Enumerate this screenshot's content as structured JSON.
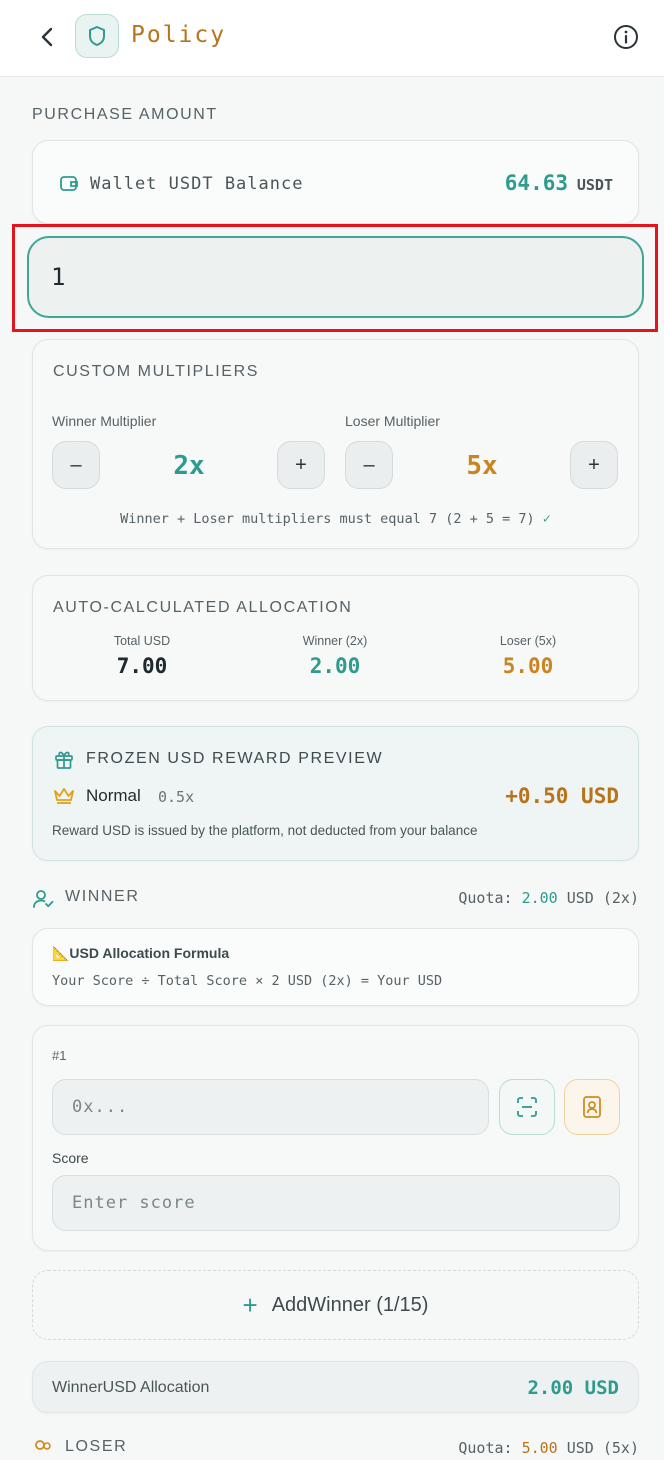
{
  "header": {
    "title": "Policy",
    "back_icon": "chevron-left-icon",
    "logo_icon": "shield-icon",
    "info_icon": "info-icon"
  },
  "purchase": {
    "section_label": "PURCHASE AMOUNT",
    "wallet_label": "Wallet USDT Balance",
    "wallet_value": "64.63",
    "wallet_unit": "USDT",
    "amount_value": "1"
  },
  "multipliers": {
    "header": "CUSTOM MULTIPLIERS",
    "winner_label": "Winner Multiplier",
    "winner_value": "2x",
    "loser_label": "Loser Multiplier",
    "loser_value": "5x",
    "minus": "–",
    "plus": "+",
    "note": "Winner + Loser multipliers must equal 7 (2 + 5 = 7)",
    "note_check": "✓"
  },
  "allocation": {
    "header": "AUTO-CALCULATED ALLOCATION",
    "total_label": "Total USD",
    "total_value": "7.00",
    "winner_label": "Winner (2x)",
    "winner_value": "2.00",
    "loser_label": "Loser (5x)",
    "loser_value": "5.00"
  },
  "frozen": {
    "header": "FROZEN USD REWARD PREVIEW",
    "tier": "Normal",
    "tier_multiplier": "0.5x",
    "reward": "+0.50 USD",
    "note": "Reward USD is issued by the platform, not deducted from your balance"
  },
  "winner": {
    "label": "WINNER",
    "quota_prefix": "Quota:",
    "quota_value": "2.00",
    "quota_suffix": "USD (2x)",
    "formula_title": "📐USD Allocation Formula",
    "formula_text": "Your Score ÷ Total Score × 2 USD (2x) = Your USD",
    "entry_number": "#1",
    "address_placeholder": "0x...",
    "score_label": "Score",
    "score_placeholder": "Enter score",
    "add_button": "AddWinner (1/15)",
    "allocation_label": "WinnerUSD Allocation",
    "allocation_value": "2.00 USD"
  },
  "loser": {
    "label": "LOSER",
    "quota_prefix": "Quota:",
    "quota_value": "5.00",
    "quota_suffix": "USD (5x)"
  },
  "colors": {
    "accent": "#2f9a8e",
    "gold": "#b7741c",
    "highlight": "#e4141c"
  }
}
